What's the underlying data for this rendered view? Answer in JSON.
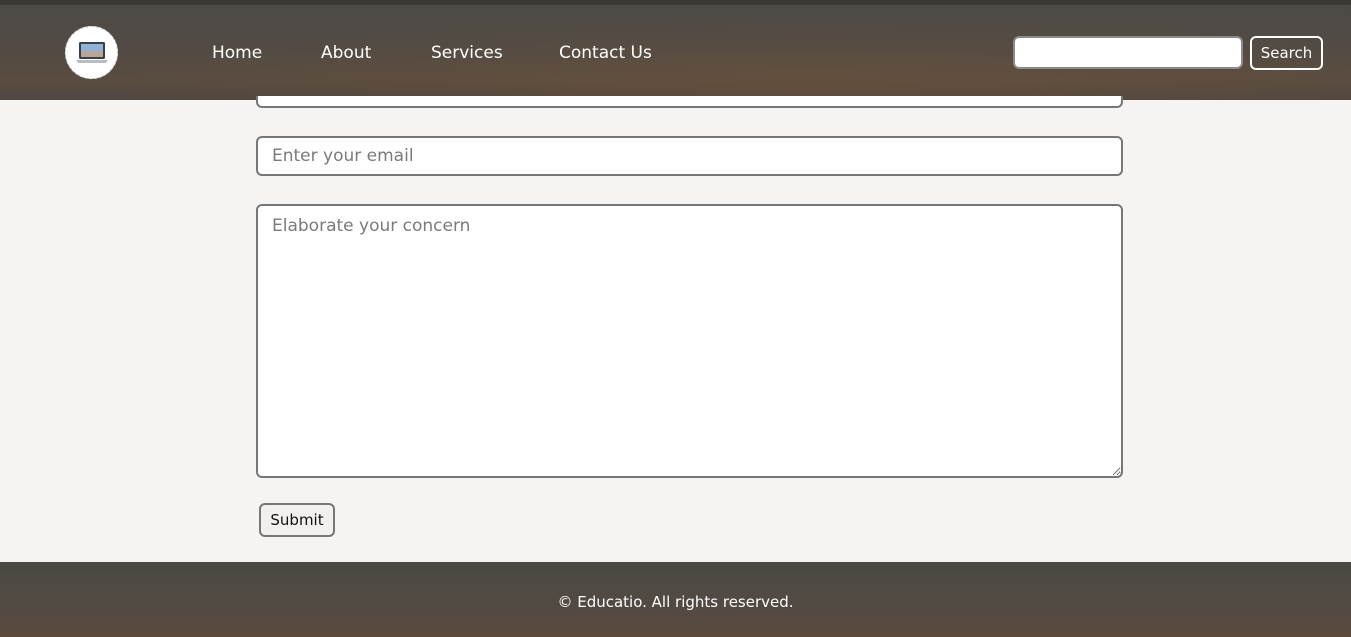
{
  "header": {
    "logo_icon": "laptop-icon",
    "nav": [
      {
        "label": "Home"
      },
      {
        "label": "About"
      },
      {
        "label": "Services"
      },
      {
        "label": "Contact Us"
      }
    ],
    "search": {
      "placeholder": "",
      "value": "",
      "button_label": "Search"
    }
  },
  "form": {
    "email_placeholder": "Enter your email",
    "concern_placeholder": "Elaborate your concern",
    "submit_label": "Submit"
  },
  "footer": {
    "text": "© Educatio. All rights reserved."
  },
  "colors": {
    "navbar_bg": "#4d4a46",
    "page_bg": "#f5f4f2",
    "input_border": "#777777",
    "text_light": "#ffffff"
  }
}
